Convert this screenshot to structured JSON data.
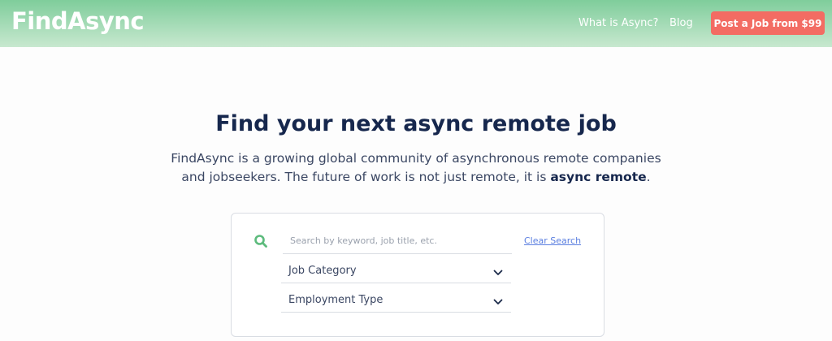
{
  "header": {
    "logo": "FindAsync",
    "nav": {
      "what_is_async": "What is Async?",
      "blog": "Blog"
    },
    "post_job_label": "Post a Job from $99"
  },
  "hero": {
    "title": "Find your next async remote job",
    "desc_part1": "FindAsync is a growing global community of asynchronous remote companies and jobseekers. The future of work is not just remote, it is ",
    "desc_bold": "async remote",
    "desc_end": "."
  },
  "search": {
    "placeholder": "Search by keyword, job title, etc.",
    "value": "",
    "clear_label": "Clear Search",
    "icon": "search-icon",
    "job_category": "Job Category",
    "employment_type": "Employment Type"
  },
  "colors": {
    "header_green": "#7fcd9b",
    "accent_button": "#f36c63",
    "title_navy": "#16274d",
    "search_icon_green": "#5dbb7d",
    "link_blue": "#5b7fe0"
  }
}
